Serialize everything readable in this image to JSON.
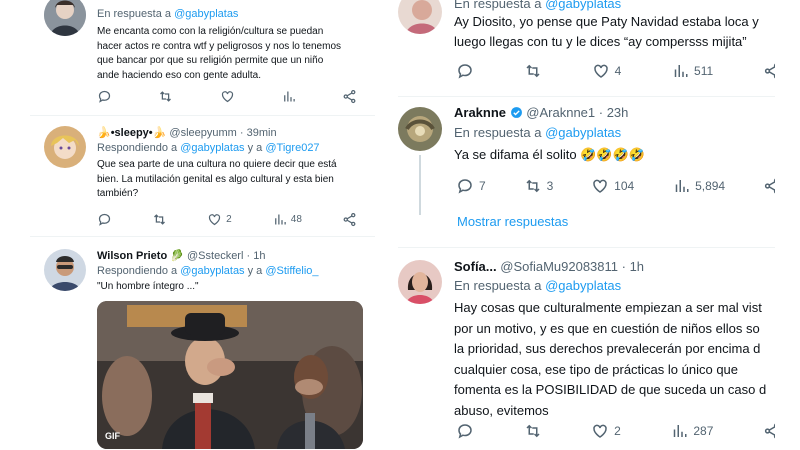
{
  "left": {
    "tweet1": {
      "reply_prefix": "En respuesta a",
      "reply_handle": "@gabyplatas",
      "text_lines": [
        "Me encanta como con la religión/cultura se puedan",
        "hacer actos re contra wtf y peligrosos y nos lo tenemos",
        "que bancar por que su religión permite que un niño",
        "ande haciendo eso con gente adulta."
      ]
    },
    "tweet2": {
      "name": "🍌•sleepy•🍌",
      "handle": "@sleepyumm",
      "time": "· 39min",
      "reply_prefix": "Respondiendo a",
      "reply_handle1": "@gabyplatas",
      "reply_and": "y a",
      "reply_handle2": "@Tigre027",
      "text_lines": [
        "Que sea parte de una cultura no quiere decir que está",
        "bien. La mutilación genital es algo cultural y esta bien",
        "también?"
      ],
      "likes": "2",
      "views": "48"
    },
    "tweet3": {
      "name": "Wilson Prieto",
      "emoji": "🥬",
      "handle": "@Ssteckerl",
      "time": "· 1h",
      "reply_prefix": "Respondiendo a",
      "reply_handle1": "@gabyplatas",
      "reply_and": "y a",
      "reply_handle2": "@Stiffelio_",
      "text": "\"Un hombre íntegro ...\"",
      "gif_badge": "GIF"
    }
  },
  "right": {
    "tweet1": {
      "reply_prefix": "En respuesta a",
      "reply_handle": "@gabyplatas",
      "text_lines": [
        "Ay Diosito, yo pense que Paty Navidad estaba loca y",
        "luego llegas con tu y le dices “ay compersss mijita”"
      ],
      "likes": "4",
      "views": "511"
    },
    "tweet2": {
      "name": "Araknne",
      "handle": "@Araknne1",
      "time": "· 23h",
      "reply_prefix": "En respuesta a",
      "reply_handle": "@gabyplatas",
      "text": "Ya se difama él solito 🤣🤣🤣🤣",
      "replies": "7",
      "retweets": "3",
      "likes": "104",
      "views": "5,894",
      "show_replies": "Mostrar respuestas"
    },
    "tweet3": {
      "name": "Sofía...",
      "handle": "@SofiaMu92083811",
      "time": "· 1h",
      "reply_prefix": "En respuesta a",
      "reply_handle": "@gabyplatas",
      "text_lines": [
        "Hay cosas que culturalmente empiezan a ser mal vist",
        "por un motivo, y es que en cuestión de niños ellos so",
        "la prioridad, sus derechos prevalecerán por encima d",
        "cualquier cosa, ese tipo de prácticas lo único que",
        "fomenta es la POSIBILIDAD de que suceda un caso d",
        "abuso, evitemos"
      ],
      "likes": "2",
      "views": "287"
    }
  },
  "colors": {
    "accent": "#1d9bf0",
    "muted": "#536471",
    "text": "#0f1419",
    "separator": "#eff3f4"
  },
  "icons": [
    "reply-icon",
    "retweet-icon",
    "like-icon",
    "views-icon",
    "share-icon",
    "verified-icon"
  ]
}
